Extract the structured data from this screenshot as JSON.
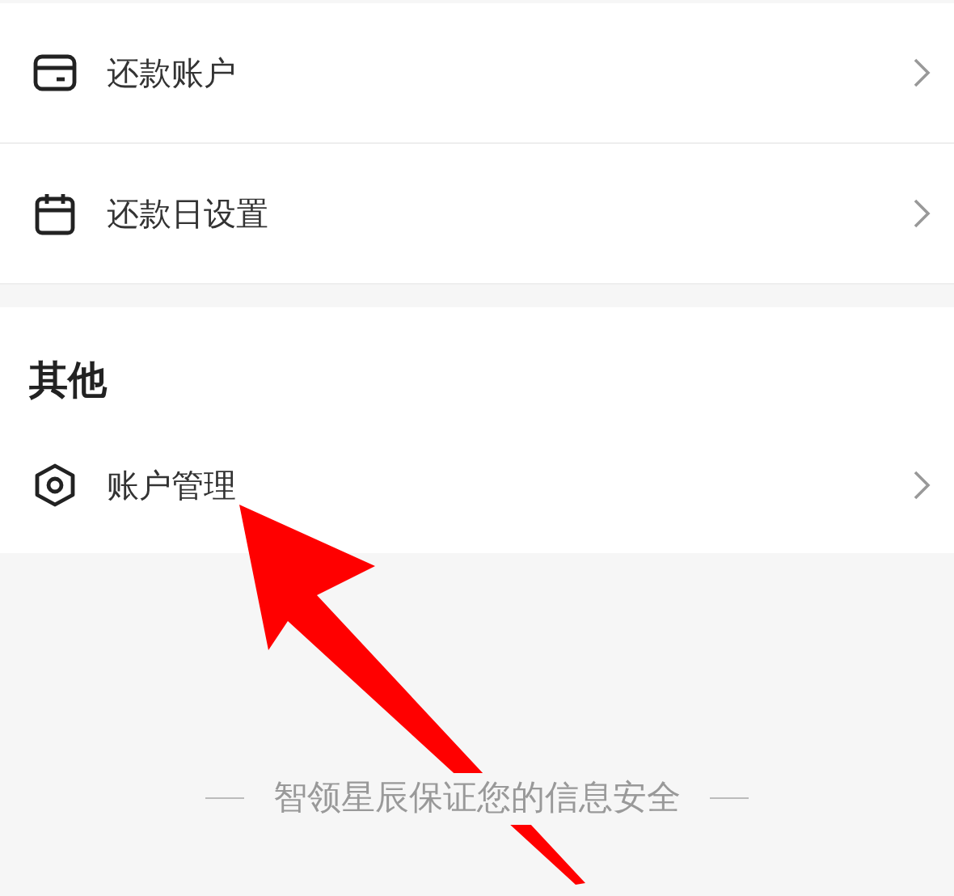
{
  "settings_rows": [
    {
      "kind": "card",
      "label": "还款账户"
    },
    {
      "kind": "calendar",
      "label": "还款日设置"
    }
  ],
  "other_section": {
    "title": "其他",
    "rows": [
      {
        "kind": "hexagon",
        "label": "账户管理"
      }
    ]
  },
  "footer": {
    "text": "智领星辰保证您的信息安全"
  }
}
